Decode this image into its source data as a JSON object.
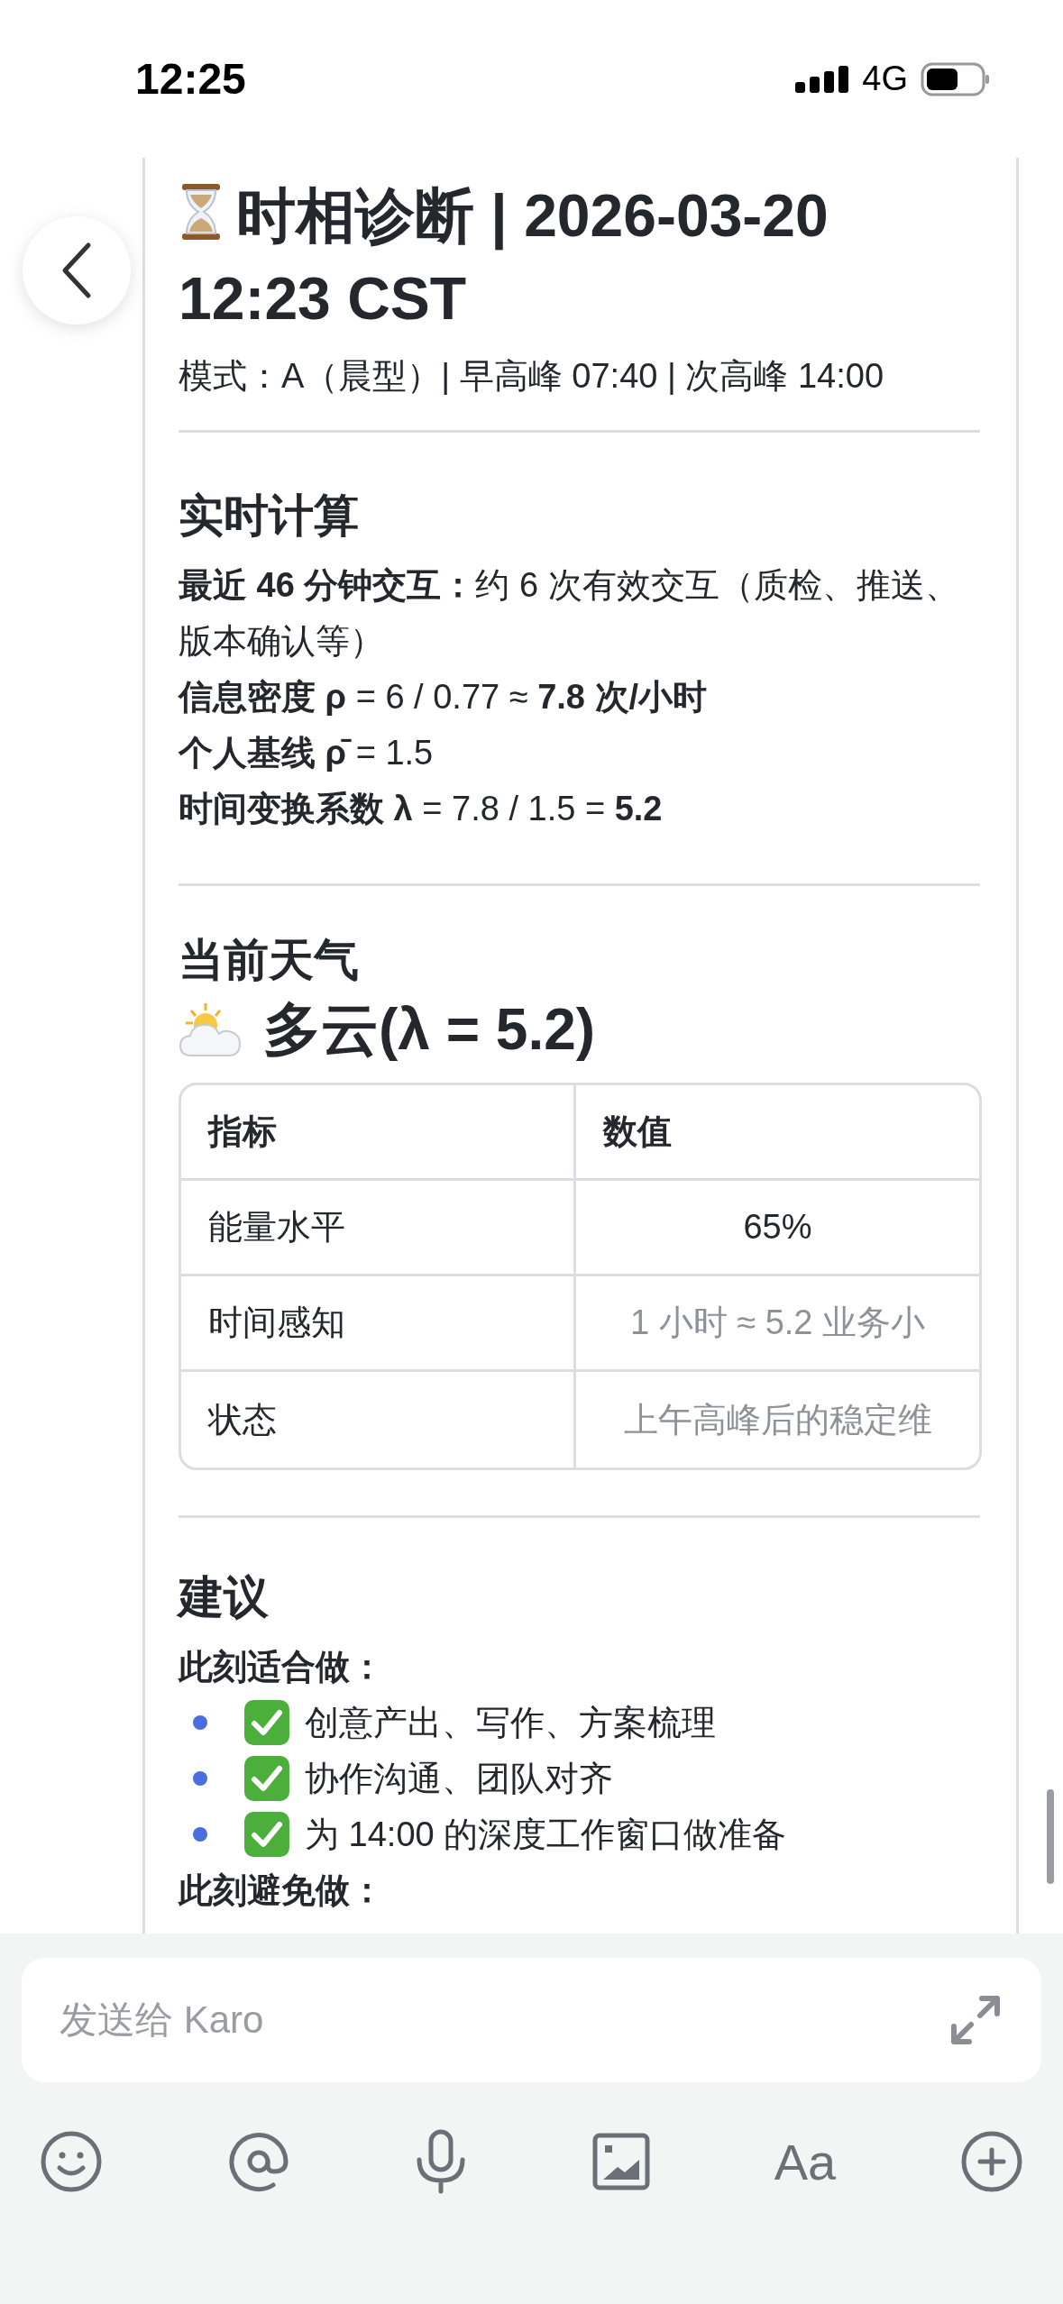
{
  "status_bar": {
    "time": "12:25",
    "network": "4G"
  },
  "document": {
    "title": "时相诊断 | 2026-03-20 12:23 CST",
    "subtitle": "模式：A（晨型）| 早高峰 07:40 | 次高峰 14:00",
    "calc": {
      "heading": "实时计算",
      "lines": [
        "**最近 46 分钟交互：**约 6 次有效交互（质检、推送、版本确认等）",
        "**信息密度 ρ** = 6 / 0.77 ≈ **7.8 次/小时**",
        "**个人基线 ρ̄** = 1.5",
        "**时间变换系数 λ** = 7.8 / 1.5 = **5.2**"
      ]
    },
    "weather": {
      "heading": "当前天气",
      "summary": "多云(λ = 5.2)",
      "table": {
        "columns": [
          "指标",
          "数值"
        ],
        "rows": [
          {
            "cells": [
              "能量水平",
              "65%"
            ],
            "faded": false
          },
          {
            "cells": [
              "时间感知",
              "1 小时 ≈ 5.2 业务小"
            ],
            "faded": true
          },
          {
            "cells": [
              "状态",
              "上午高峰后的稳定维"
            ],
            "faded": true
          }
        ]
      }
    },
    "advice": {
      "heading": "建议",
      "groups": [
        {
          "label": "此刻适合做：",
          "items": [
            "创意产出、写作、方案梳理",
            "协作沟通、团队对齐",
            "为 14:00 的深度工作窗口做准备"
          ]
        },
        {
          "label": "此刻避免做："
        }
      ]
    }
  },
  "composer": {
    "placeholder": "发送给 Karo"
  },
  "toolbar": [
    {
      "kind": "emoji"
    },
    {
      "kind": "mention"
    },
    {
      "kind": "voice"
    },
    {
      "kind": "image"
    },
    {
      "kind": "format",
      "label": "Aa"
    },
    {
      "kind": "add"
    }
  ]
}
